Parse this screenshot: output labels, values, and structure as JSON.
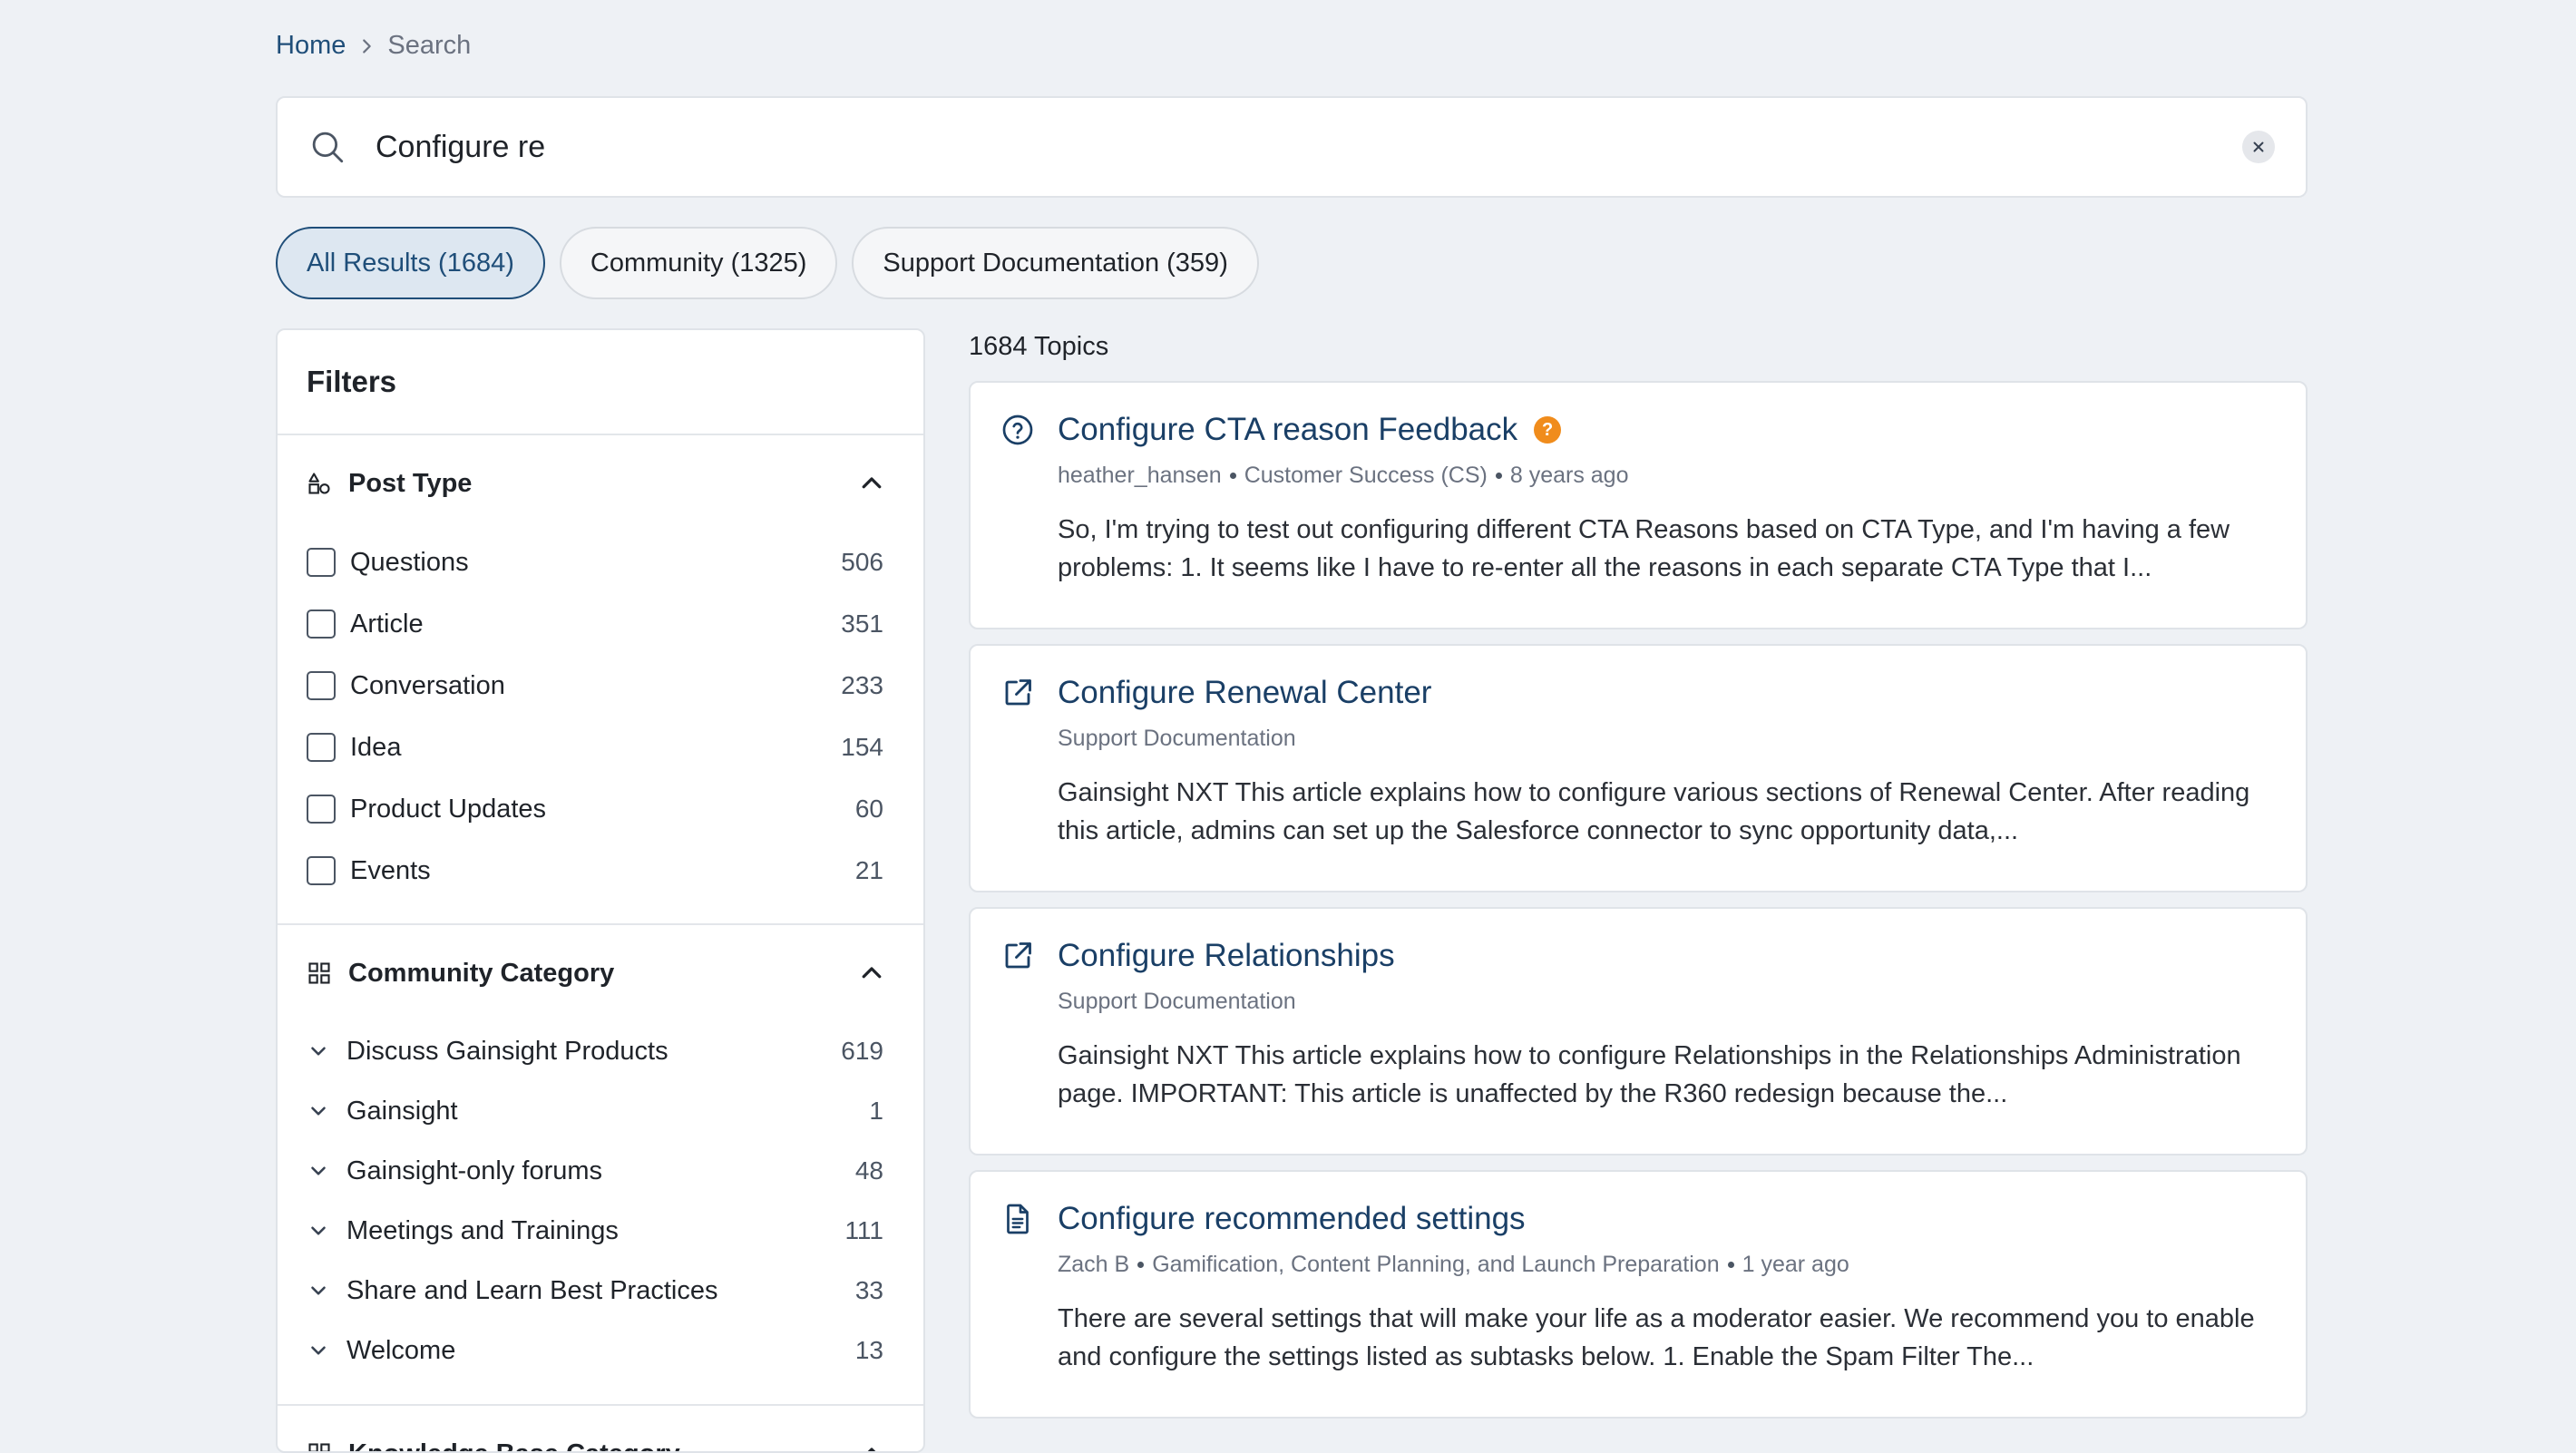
{
  "breadcrumb": {
    "home": "Home",
    "current": "Search"
  },
  "search": {
    "value": "Configure re",
    "placeholder": ""
  },
  "tabs": [
    {
      "label": "All Results (1684)",
      "active": true
    },
    {
      "label": "Community (1325)",
      "active": false
    },
    {
      "label": "Support Documentation (359)",
      "active": false
    }
  ],
  "filters": {
    "title": "Filters",
    "post_type": {
      "title": "Post Type",
      "options": [
        {
          "label": "Questions",
          "count": "506"
        },
        {
          "label": "Article",
          "count": "351"
        },
        {
          "label": "Conversation",
          "count": "233"
        },
        {
          "label": "Idea",
          "count": "154"
        },
        {
          "label": "Product Updates",
          "count": "60"
        },
        {
          "label": "Events",
          "count": "21"
        }
      ]
    },
    "community_category": {
      "title": "Community Category",
      "options": [
        {
          "label": "Discuss Gainsight Products",
          "count": "619"
        },
        {
          "label": "Gainsight",
          "count": "1"
        },
        {
          "label": "Gainsight-only forums",
          "count": "48"
        },
        {
          "label": "Meetings and Trainings",
          "count": "111"
        },
        {
          "label": "Share and Learn Best Practices",
          "count": "33"
        },
        {
          "label": "Welcome",
          "count": "13"
        }
      ]
    },
    "knowledge_base_category": {
      "title": "Knowledge Base Category"
    }
  },
  "results": {
    "count_label": "1684 Topics",
    "items": [
      {
        "icon": "question-circle-icon",
        "title": "Configure CTA reason Feedback",
        "badge": "?",
        "meta": [
          "heather_hansen",
          "Customer Success (CS)",
          "8 years ago"
        ],
        "excerpt": "So, I'm trying to test out configuring different CTA Reasons based on CTA Type, and I'm having a few problems: 1. It seems like I have to re-enter all the reasons in each separate CTA Type that I..."
      },
      {
        "icon": "external-link-icon",
        "title": "Configure Renewal Center",
        "meta": [
          "Support Documentation"
        ],
        "excerpt": "Gainsight NXT This article explains how to configure various sections of Renewal Center. After reading this article, admins can set up the Salesforce connector to sync opportunity data,..."
      },
      {
        "icon": "external-link-icon",
        "title": "Configure Relationships",
        "meta": [
          "Support Documentation"
        ],
        "excerpt": "Gainsight NXT This article explains how to configure Relationships in the Relationships Administration page. IMPORTANT: This article is unaffected by the R360 redesign because the..."
      },
      {
        "icon": "document-icon",
        "title": "Configure recommended settings",
        "meta": [
          "Zach B",
          "Gamification, Content Planning, and Launch Preparation",
          "1 year ago"
        ],
        "excerpt": "There are several settings that will make your life as a moderator easier. We recommend you to enable and configure the settings listed as subtasks below. 1. Enable the Spam Filter The..."
      }
    ]
  },
  "colors": {
    "accent": "#1f4e79",
    "badge": "#f08c1c",
    "background": "#eef1f5"
  }
}
